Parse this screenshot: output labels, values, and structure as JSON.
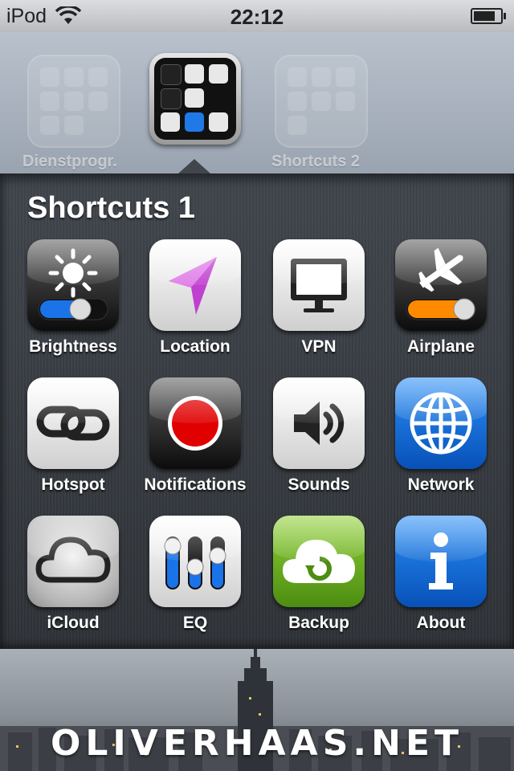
{
  "status_bar": {
    "carrier": "iPod",
    "time": "22:12"
  },
  "folders": [
    {
      "label": "Dienstprogr."
    },
    {
      "label": ""
    },
    {
      "label": "Shortcuts 2"
    }
  ],
  "open_folder": {
    "title": "Shortcuts 1",
    "apps": [
      {
        "label": "Brightness",
        "icon": "brightness-icon"
      },
      {
        "label": "Location",
        "icon": "location-arrow-icon"
      },
      {
        "label": "VPN",
        "icon": "monitor-icon"
      },
      {
        "label": "Airplane",
        "icon": "airplane-icon"
      },
      {
        "label": "Hotspot",
        "icon": "chain-link-icon"
      },
      {
        "label": "Notifications",
        "icon": "red-dot-icon"
      },
      {
        "label": "Sounds",
        "icon": "speaker-icon"
      },
      {
        "label": "Network",
        "icon": "globe-icon"
      },
      {
        "label": "iCloud",
        "icon": "cloud-icon"
      },
      {
        "label": "EQ",
        "icon": "equalizer-icon"
      },
      {
        "label": "Backup",
        "icon": "cloud-refresh-icon"
      },
      {
        "label": "About",
        "icon": "info-icon"
      }
    ]
  },
  "watermark": "OLIVERHAAS.NET",
  "colors": {
    "toggle_blue": "#1a73e8",
    "toggle_orange": "#ff8a00",
    "notification_red": "#e00000",
    "location_purple": "#c040d0"
  }
}
